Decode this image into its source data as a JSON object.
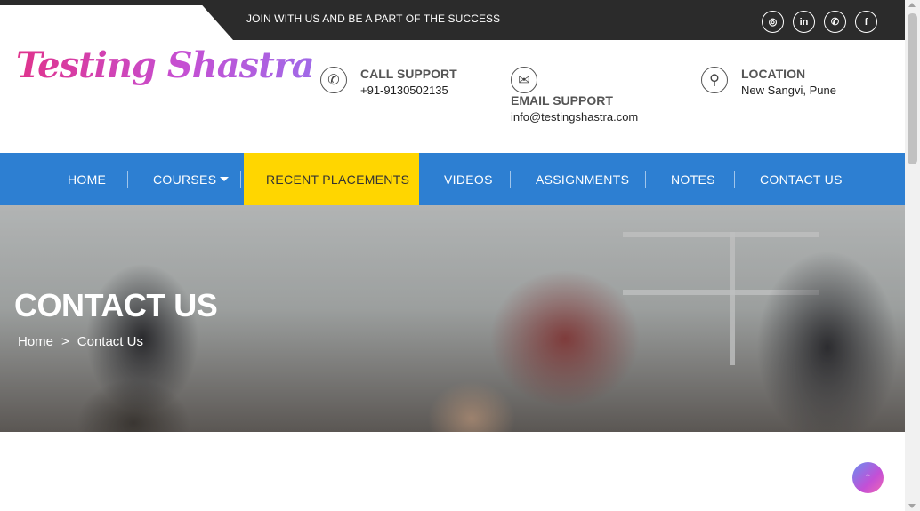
{
  "topbar": {
    "tagline": "JOIN WITH US AND BE A PART OF THE SUCCESS",
    "socials": [
      {
        "icon": "instagram-icon",
        "glyph": "◎"
      },
      {
        "icon": "linkedin-icon",
        "glyph": "in"
      },
      {
        "icon": "whatsapp-icon",
        "glyph": "✆"
      },
      {
        "icon": "facebook-icon",
        "glyph": "f"
      }
    ]
  },
  "header": {
    "logo": "Testing Shastra",
    "call": {
      "title": "CALL SUPPORT",
      "value": "+91-9130502135",
      "icon": "phone-icon",
      "glyph": "✆"
    },
    "email": {
      "title": "EMAIL SUPPORT",
      "value": "info@testingshastra.com",
      "icon": "envelope-icon",
      "glyph": "✉"
    },
    "location": {
      "title": "LOCATION",
      "value": "New Sangvi, Pune",
      "icon": "map-pin-icon",
      "glyph": "⚲"
    }
  },
  "nav": {
    "items": [
      "HOME",
      "COURSES",
      "RECENT PLACEMENTS",
      "VIDEOS",
      "ASSIGNMENTS",
      "NOTES",
      "CONTACT US"
    ],
    "active": "RECENT PLACEMENTS",
    "colors": {
      "bar": "#2d7fd2",
      "active": "#ffd600"
    }
  },
  "hero": {
    "title": "CONTACT US",
    "breadcrumb": [
      "Home",
      ">",
      "Contact Us"
    ]
  },
  "scroll_top": {
    "icon": "arrow-up-icon",
    "glyph": "↑"
  }
}
